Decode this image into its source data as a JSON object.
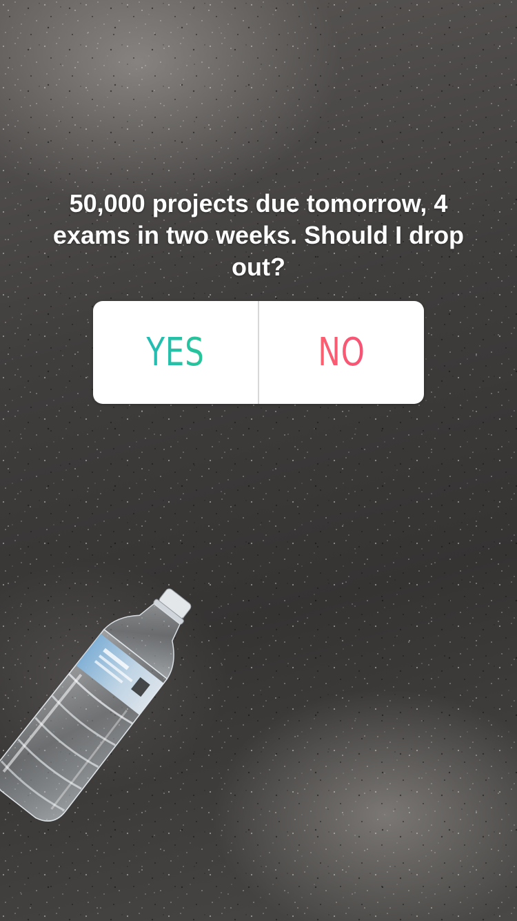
{
  "story": {
    "question": "50,000 projects due tomorrow, 4 exams in two weeks. Should I drop out?",
    "poll": {
      "option_yes": "YES",
      "option_no": "NO",
      "colors": {
        "yes_gradient": [
          "#1fb7c8",
          "#2cc985"
        ],
        "no_gradient": [
          "#ff6b6b",
          "#f2487a"
        ],
        "card": "#ffffff",
        "divider": "#d7d7d7"
      }
    },
    "background": {
      "surface": "speckled dark gray countertop",
      "object": "water-bottle"
    }
  }
}
